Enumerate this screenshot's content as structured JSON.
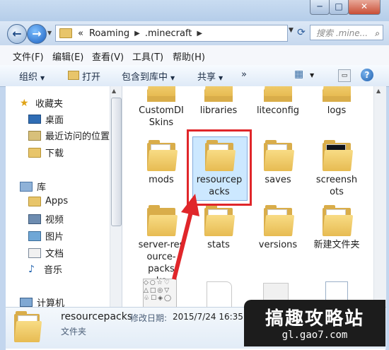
{
  "window": {
    "controls": {
      "minimize": "─",
      "maximize": "□",
      "close": "✕"
    }
  },
  "address": {
    "overflow": "«",
    "crumbs": [
      "Roaming",
      ".minecraft"
    ],
    "search_placeholder": "搜索 .mine..."
  },
  "menu": [
    "文件(F)",
    "编辑(E)",
    "查看(V)",
    "工具(T)",
    "帮助(H)"
  ],
  "toolbar": {
    "organize": "组织",
    "open": "打开",
    "include": "包含到库中",
    "share": "共享",
    "more": "»"
  },
  "nav": {
    "favorites": "收藏夹",
    "desktop": "桌面",
    "recent": "最近访问的位置",
    "downloads": "下载",
    "libraries": "库",
    "apps": "Apps",
    "videos": "视频",
    "pictures": "图片",
    "documents": "文档",
    "music": "音乐",
    "computer": "计算机"
  },
  "files": [
    "CustomDI\nSkins",
    "libraries",
    "liteconfig",
    "logs",
    "mods",
    "resourcep\nacks",
    "saves",
    "screensh\nots",
    "server-res\nource-packs\nks",
    "stats",
    "versions",
    "新建文件夹"
  ],
  "details": {
    "name": "resourcepacks",
    "date_label": "修改日期:",
    "date_value": "2015/7/24 16:35",
    "type": "文件夹"
  },
  "watermark": {
    "title": "搞趣攻略站",
    "url": "gl.gao7.com"
  },
  "colors": {
    "selection": "#cce8ff",
    "highlight_box": "#e0262a",
    "folder": "#e7bb52"
  }
}
